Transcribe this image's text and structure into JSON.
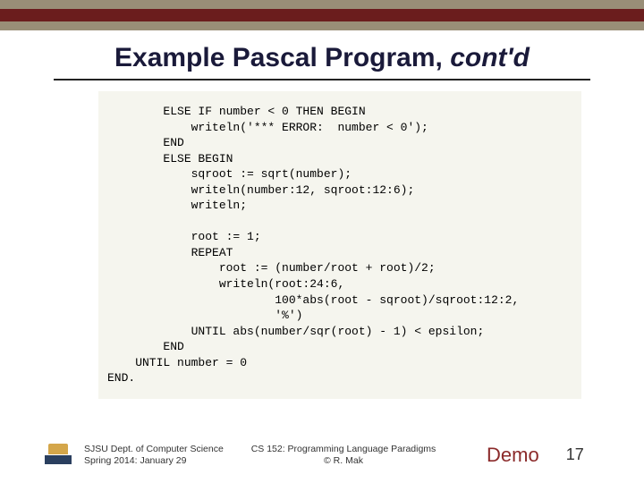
{
  "title_main": "Example Pascal Program, ",
  "title_italic": "cont'd",
  "code": "        ELSE IF number < 0 THEN BEGIN\n            writeln('*** ERROR:  number < 0');\n        END\n        ELSE BEGIN\n            sqroot := sqrt(number);\n            writeln(number:12, sqroot:12:6);\n            writeln;\n\n            root := 1;\n            REPEAT\n                root := (number/root + root)/2;\n                writeln(root:24:6,\n                        100*abs(root - sqroot)/sqroot:12:2,\n                        '%')\n            UNTIL abs(number/sqr(root) - 1) < epsilon;\n        END\n    UNTIL number = 0\nEND.",
  "footer": {
    "dept_line1": "SJSU Dept. of Computer Science",
    "dept_line2": "Spring 2014: January 29",
    "course_line1": "CS 152: Programming Language Paradigms",
    "course_line2": "© R. Mak",
    "demo": "Demo",
    "page": "17"
  }
}
